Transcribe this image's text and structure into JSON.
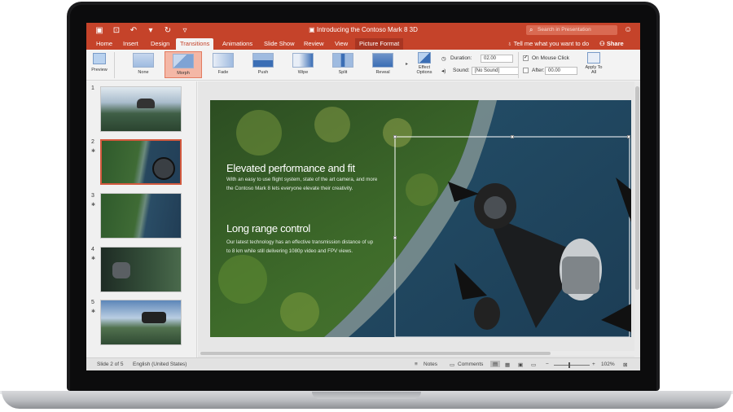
{
  "app": {
    "doc_title": "Introducing the Contoso Mark 8 3D",
    "search_placeholder": "Search in Presentation"
  },
  "tabs": [
    "Home",
    "Insert",
    "Design",
    "Transitions",
    "Animations",
    "Slide Show",
    "Review",
    "View",
    "Picture Format"
  ],
  "active_tab": "Transitions",
  "tell_me": "Tell me what you want to do",
  "share_label": "Share",
  "ribbon": {
    "preview": "Preview",
    "transitions": [
      "None",
      "Morph",
      "Fade",
      "Push",
      "Wipe",
      "Split",
      "Reveal"
    ],
    "selected_transition": "Morph",
    "effect_options": "Effect Options",
    "duration_label": "Duration:",
    "duration_value": "02.00",
    "sound_label": "Sound:",
    "sound_value": "[No Sound]",
    "on_mouse_click": "On Mouse Click",
    "after_label": "After:",
    "after_value": "00.00",
    "apply_to_all": "Apply To All"
  },
  "slides": [
    {
      "num": "1"
    },
    {
      "num": "2"
    },
    {
      "num": "3"
    },
    {
      "num": "4"
    },
    {
      "num": "5"
    }
  ],
  "slide_content": {
    "heading1": "Elevated performance and fit",
    "body1_line1": "With an easy to use flight system, state of the art camera, and more",
    "body1_line2": "the Contoso Mark 8 lets everyone elevate their creativity.",
    "heading2": "Long range control",
    "body2_line1": "Our latest technology has an effective transmission distance of up",
    "body2_line2": "to 8 km while still delivering 1080p video and FPV views."
  },
  "status": {
    "slide_indicator": "Slide 2 of 5",
    "language": "English (United States)",
    "notes": "Notes",
    "comments": "Comments",
    "zoom": "102%"
  },
  "colors": {
    "accent": "#c5432a",
    "selected_thumb_border": "#d3593e"
  }
}
